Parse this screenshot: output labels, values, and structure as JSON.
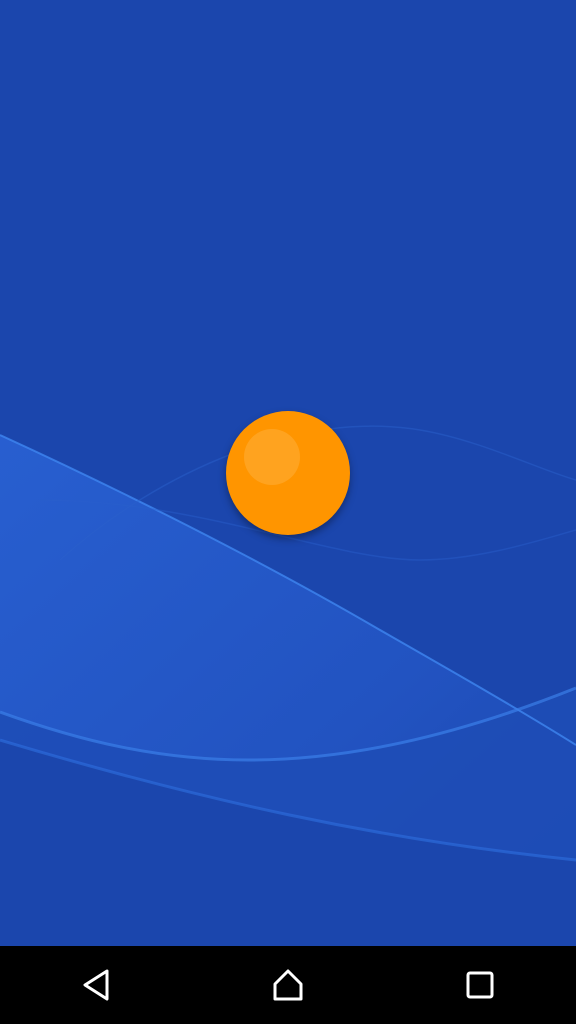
{
  "screen": {
    "name": "home-screen-wallpaper",
    "background_color": "#1b46ad",
    "accent_orb_color": "#ff9500"
  },
  "navbar": {
    "background_color": "#000000",
    "icon_color": "#ffffff",
    "buttons": [
      {
        "name": "back-button",
        "icon": "back-triangle-icon"
      },
      {
        "name": "home-button",
        "icon": "home-icon"
      },
      {
        "name": "recents-button",
        "icon": "recents-square-icon"
      }
    ]
  }
}
